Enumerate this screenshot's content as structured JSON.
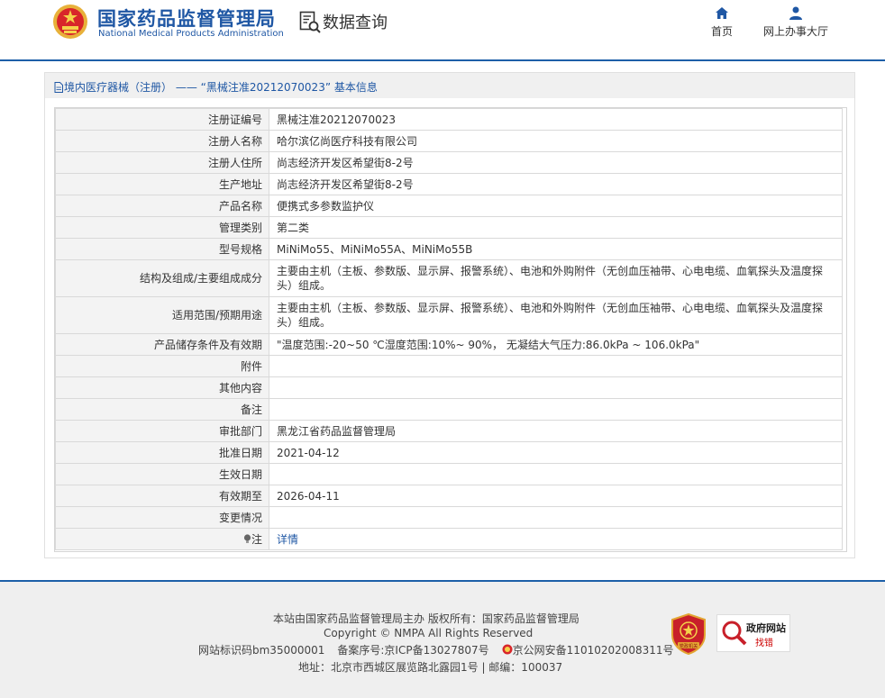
{
  "header": {
    "logo_cn": "国家药品监督管理局",
    "logo_en": "National Medical Products Administration",
    "query_title": "数据查询",
    "nav": [
      {
        "label": "首页",
        "icon": "home-icon"
      },
      {
        "label": "网上办事大厅",
        "icon": "user-icon"
      }
    ]
  },
  "panel": {
    "title": "境内医疗器械（注册） —— “黑械注准20212070023” 基本信息"
  },
  "rows": [
    {
      "label": "注册证编号",
      "value": "黑械注准20212070023"
    },
    {
      "label": "注册人名称",
      "value": "哈尔滨亿尚医疗科技有限公司"
    },
    {
      "label": "注册人住所",
      "value": "尚志经济开发区希望街8-2号"
    },
    {
      "label": "生产地址",
      "value": "尚志经济开发区希望街8-2号"
    },
    {
      "label": "产品名称",
      "value": "便携式多参数监护仪"
    },
    {
      "label": "管理类别",
      "value": "第二类"
    },
    {
      "label": "型号规格",
      "value": "MiNiMo55、MiNiMo55A、MiNiMo55B"
    },
    {
      "label": "结构及组成/主要组成成分",
      "value": "主要由主机（主板、参数版、显示屏、报警系统）、电池和外购附件（无创血压袖带、心电电缆、血氧探头及温度探头）组成。"
    },
    {
      "label": "适用范围/预期用途",
      "value": "主要由主机（主板、参数版、显示屏、报警系统）、电池和外购附件（无创血压袖带、心电电缆、血氧探头及温度探头）组成。"
    },
    {
      "label": "产品储存条件及有效期",
      "value": "\"温度范围:-20~50 ℃湿度范围:10%~ 90%， 无凝结大气压力:86.0kPa ~ 106.0kPa\""
    },
    {
      "label": "附件",
      "value": ""
    },
    {
      "label": "其他内容",
      "value": ""
    },
    {
      "label": "备注",
      "value": ""
    },
    {
      "label": "审批部门",
      "value": "黑龙江省药品监督管理局"
    },
    {
      "label": "批准日期",
      "value": "2021-04-12"
    },
    {
      "label": "生效日期",
      "value": ""
    },
    {
      "label": "有效期至",
      "value": "2026-04-11"
    },
    {
      "label": "变更情况",
      "value": ""
    }
  ],
  "note_row": {
    "label": "注",
    "link": "详情",
    "icon": "lightbulb-icon"
  },
  "footer": {
    "line1": "本站由国家药品监督管理局主办 版权所有：国家药品监督管理局",
    "line2": "Copyright © NMPA All Rights Reserved",
    "site_id": "网站标识码bm35000001",
    "icp": "备案序号:京ICP备13027807号",
    "police": "京公网安备11010202008311号",
    "address": "地址：北京市西城区展览路北露园1号 | 邮编：100037",
    "badge1_label": "党政机关",
    "badge2_title": "政府网站",
    "badge2_sub": "找错"
  },
  "colors": {
    "brand": "#1f57a4",
    "header_line": "#1d5fa8",
    "label_bg": "#f3f3f3",
    "footer_bg": "#efefef"
  }
}
